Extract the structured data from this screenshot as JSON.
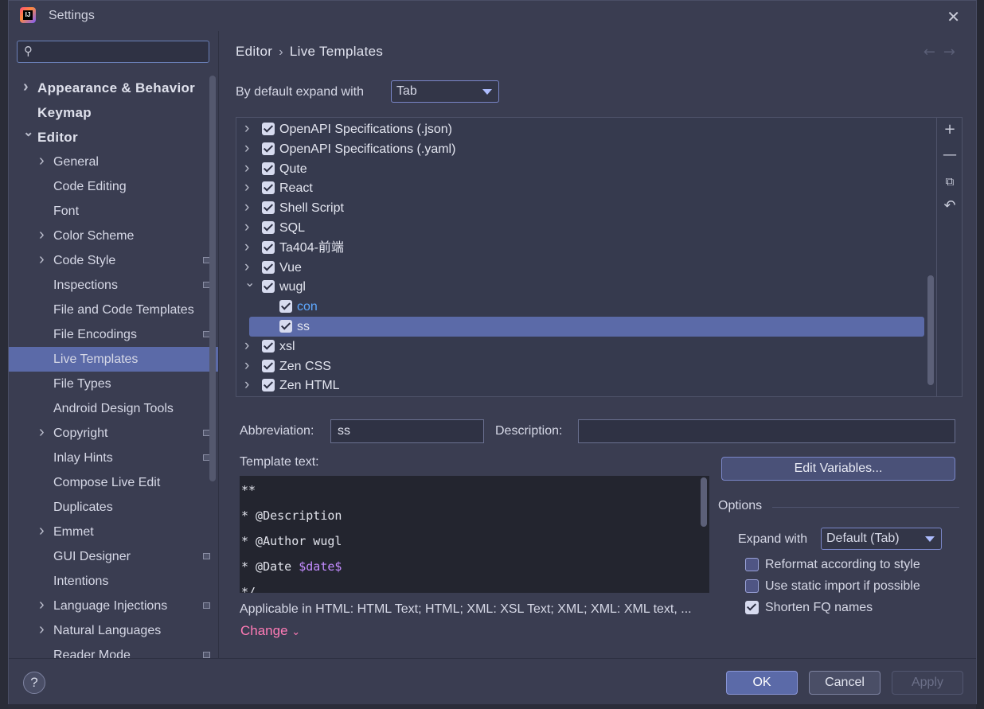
{
  "window": {
    "title": "Settings"
  },
  "sidebar": {
    "search": {
      "placeholder": ""
    },
    "items": [
      {
        "label": "Appearance & Behavior",
        "level": 0,
        "expandable": true,
        "expanded": false,
        "badge": false,
        "selected": false
      },
      {
        "label": "Keymap",
        "level": 0,
        "expandable": false,
        "expanded": false,
        "badge": false,
        "selected": false
      },
      {
        "label": "Editor",
        "level": 0,
        "expandable": true,
        "expanded": true,
        "badge": false,
        "selected": false
      },
      {
        "label": "General",
        "level": 1,
        "expandable": true,
        "expanded": false,
        "badge": false,
        "selected": false
      },
      {
        "label": "Code Editing",
        "level": 1,
        "expandable": false,
        "expanded": false,
        "badge": false,
        "selected": false
      },
      {
        "label": "Font",
        "level": 1,
        "expandable": false,
        "expanded": false,
        "badge": false,
        "selected": false
      },
      {
        "label": "Color Scheme",
        "level": 1,
        "expandable": true,
        "expanded": false,
        "badge": false,
        "selected": false
      },
      {
        "label": "Code Style",
        "level": 1,
        "expandable": true,
        "expanded": false,
        "badge": true,
        "selected": false
      },
      {
        "label": "Inspections",
        "level": 1,
        "expandable": false,
        "expanded": false,
        "badge": true,
        "selected": false
      },
      {
        "label": "File and Code Templates",
        "level": 1,
        "expandable": false,
        "expanded": false,
        "badge": false,
        "selected": false
      },
      {
        "label": "File Encodings",
        "level": 1,
        "expandable": false,
        "expanded": false,
        "badge": true,
        "selected": false
      },
      {
        "label": "Live Templates",
        "level": 1,
        "expandable": false,
        "expanded": false,
        "badge": false,
        "selected": true
      },
      {
        "label": "File Types",
        "level": 1,
        "expandable": false,
        "expanded": false,
        "badge": false,
        "selected": false
      },
      {
        "label": "Android Design Tools",
        "level": 1,
        "expandable": false,
        "expanded": false,
        "badge": false,
        "selected": false
      },
      {
        "label": "Copyright",
        "level": 1,
        "expandable": true,
        "expanded": false,
        "badge": true,
        "selected": false
      },
      {
        "label": "Inlay Hints",
        "level": 1,
        "expandable": false,
        "expanded": false,
        "badge": true,
        "selected": false
      },
      {
        "label": "Compose Live Edit",
        "level": 1,
        "expandable": false,
        "expanded": false,
        "badge": false,
        "selected": false
      },
      {
        "label": "Duplicates",
        "level": 1,
        "expandable": false,
        "expanded": false,
        "badge": false,
        "selected": false
      },
      {
        "label": "Emmet",
        "level": 1,
        "expandable": true,
        "expanded": false,
        "badge": false,
        "selected": false
      },
      {
        "label": "GUI Designer",
        "level": 1,
        "expandable": false,
        "expanded": false,
        "badge": true,
        "selected": false
      },
      {
        "label": "Intentions",
        "level": 1,
        "expandable": false,
        "expanded": false,
        "badge": false,
        "selected": false
      },
      {
        "label": "Language Injections",
        "level": 1,
        "expandable": true,
        "expanded": false,
        "badge": true,
        "selected": false
      },
      {
        "label": "Natural Languages",
        "level": 1,
        "expandable": true,
        "expanded": false,
        "badge": false,
        "selected": false
      },
      {
        "label": "Reader Mode",
        "level": 1,
        "expandable": false,
        "expanded": false,
        "badge": true,
        "selected": false
      }
    ]
  },
  "main": {
    "breadcrumb": {
      "parent": "Editor",
      "separator": "›",
      "current": "Live Templates"
    },
    "nav": {
      "back": "←",
      "forward": "→"
    },
    "expand_default": {
      "label": "By default expand with",
      "value": "Tab"
    },
    "templates": [
      {
        "label": "OpenAPI Specifications (.json)",
        "group": true,
        "expanded": false,
        "checked": true,
        "selected": false
      },
      {
        "label": "OpenAPI Specifications (.yaml)",
        "group": true,
        "expanded": false,
        "checked": true,
        "selected": false
      },
      {
        "label": "Qute",
        "group": true,
        "expanded": false,
        "checked": true,
        "selected": false
      },
      {
        "label": "React",
        "group": true,
        "expanded": false,
        "checked": true,
        "selected": false
      },
      {
        "label": "Shell Script",
        "group": true,
        "expanded": false,
        "checked": true,
        "selected": false
      },
      {
        "label": "SQL",
        "group": true,
        "expanded": false,
        "checked": true,
        "selected": false
      },
      {
        "label": "Ta404-前端",
        "group": true,
        "expanded": false,
        "checked": true,
        "selected": false
      },
      {
        "label": "Vue",
        "group": true,
        "expanded": false,
        "checked": true,
        "selected": false
      },
      {
        "label": "wugl",
        "group": true,
        "expanded": true,
        "checked": true,
        "selected": false
      },
      {
        "label": "con",
        "group": false,
        "expanded": false,
        "checked": true,
        "selected": false,
        "color": "#5fa8ff"
      },
      {
        "label": "ss",
        "group": false,
        "expanded": false,
        "checked": true,
        "selected": true
      },
      {
        "label": "xsl",
        "group": true,
        "expanded": false,
        "checked": true,
        "selected": false
      },
      {
        "label": "Zen CSS",
        "group": true,
        "expanded": false,
        "checked": true,
        "selected": false
      },
      {
        "label": "Zen HTML",
        "group": true,
        "expanded": false,
        "checked": true,
        "selected": false
      }
    ],
    "toolbar": {
      "add": "+",
      "remove": "—",
      "copy": "⧉",
      "restore": "↶"
    },
    "abbreviation": {
      "label": "Abbreviation:",
      "value": "ss"
    },
    "description": {
      "label": "Description:",
      "value": ""
    },
    "template_text": {
      "label": "Template text:",
      "lines": [
        {
          "text": "**",
          "var": ""
        },
        {
          "text": "* @Description",
          "var": ""
        },
        {
          "text": "* @Author wugl",
          "var": ""
        },
        {
          "text": "* @Date ",
          "var": "$date$"
        },
        {
          "text": "*/",
          "var": ""
        }
      ]
    },
    "edit_variables": "Edit Variables...",
    "options": {
      "title": "Options",
      "expand_with_label": "Expand with",
      "expand_with_value": "Default (Tab)",
      "reformat": {
        "label": "Reformat according to style",
        "checked": false
      },
      "static_import": {
        "label": "Use static import if possible",
        "checked": false
      },
      "shorten_fq": {
        "label": "Shorten FQ names",
        "checked": true
      }
    },
    "applicable": "Applicable in HTML: HTML Text; HTML; XML: XSL Text; XML; XML: XML text, ...",
    "change": "Change"
  },
  "footer": {
    "help": "?",
    "ok": "OK",
    "cancel": "Cancel",
    "apply": "Apply"
  }
}
